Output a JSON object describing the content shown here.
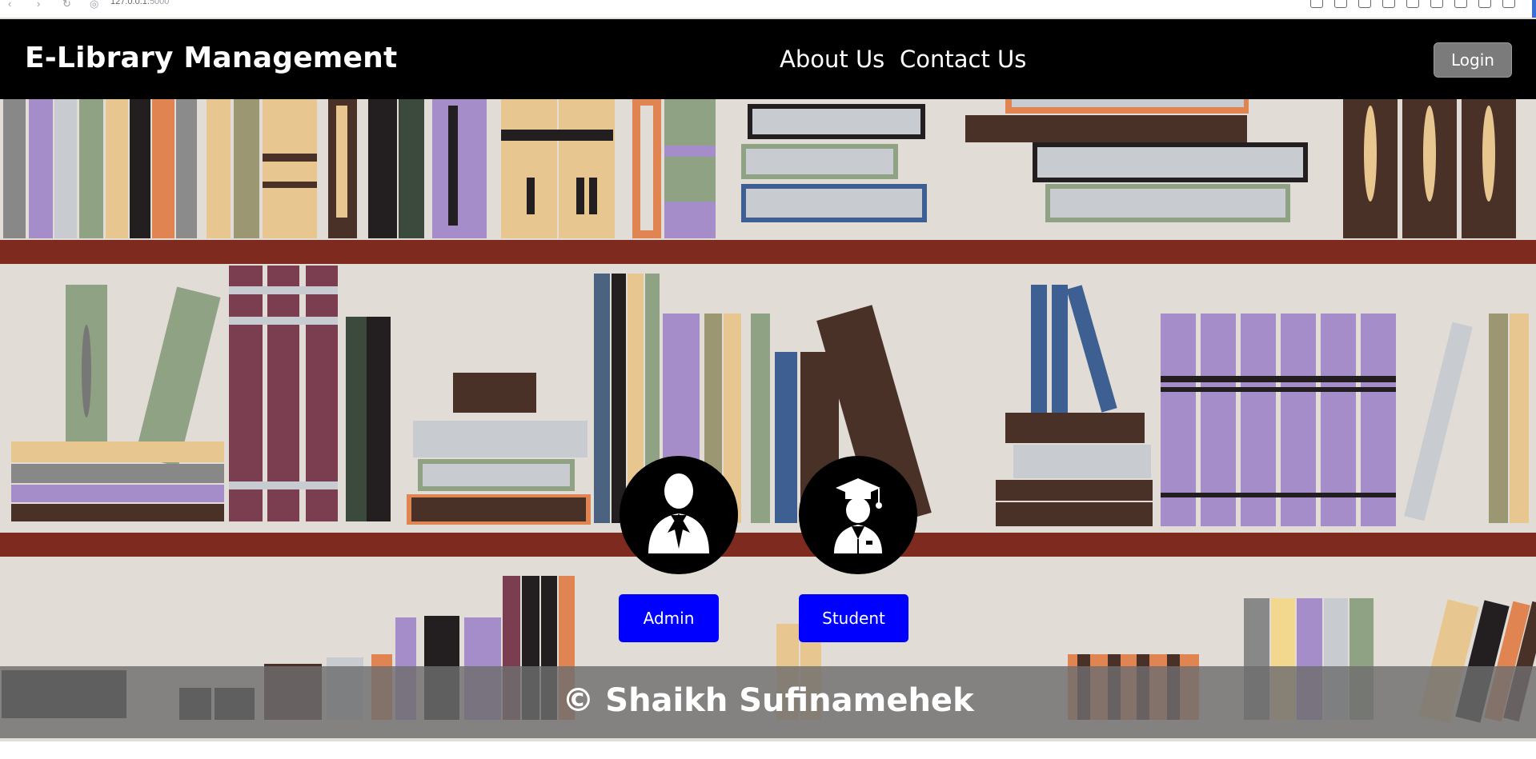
{
  "browser": {
    "url_host": "127.0.0.1:",
    "url_port": "5000"
  },
  "navbar": {
    "brand": "E-Library Management",
    "links": [
      "About Us",
      "Contact Us"
    ],
    "login_label": "Login"
  },
  "roles": {
    "admin_label": "Admin",
    "student_label": "Student"
  },
  "footer": {
    "credit": "© Shaikh Sufinamehek"
  },
  "colors": {
    "navbar_bg": "#000000",
    "role_button": "#0000ff",
    "shelf": "#7e2a1e",
    "wall": "#e1ddd6"
  }
}
